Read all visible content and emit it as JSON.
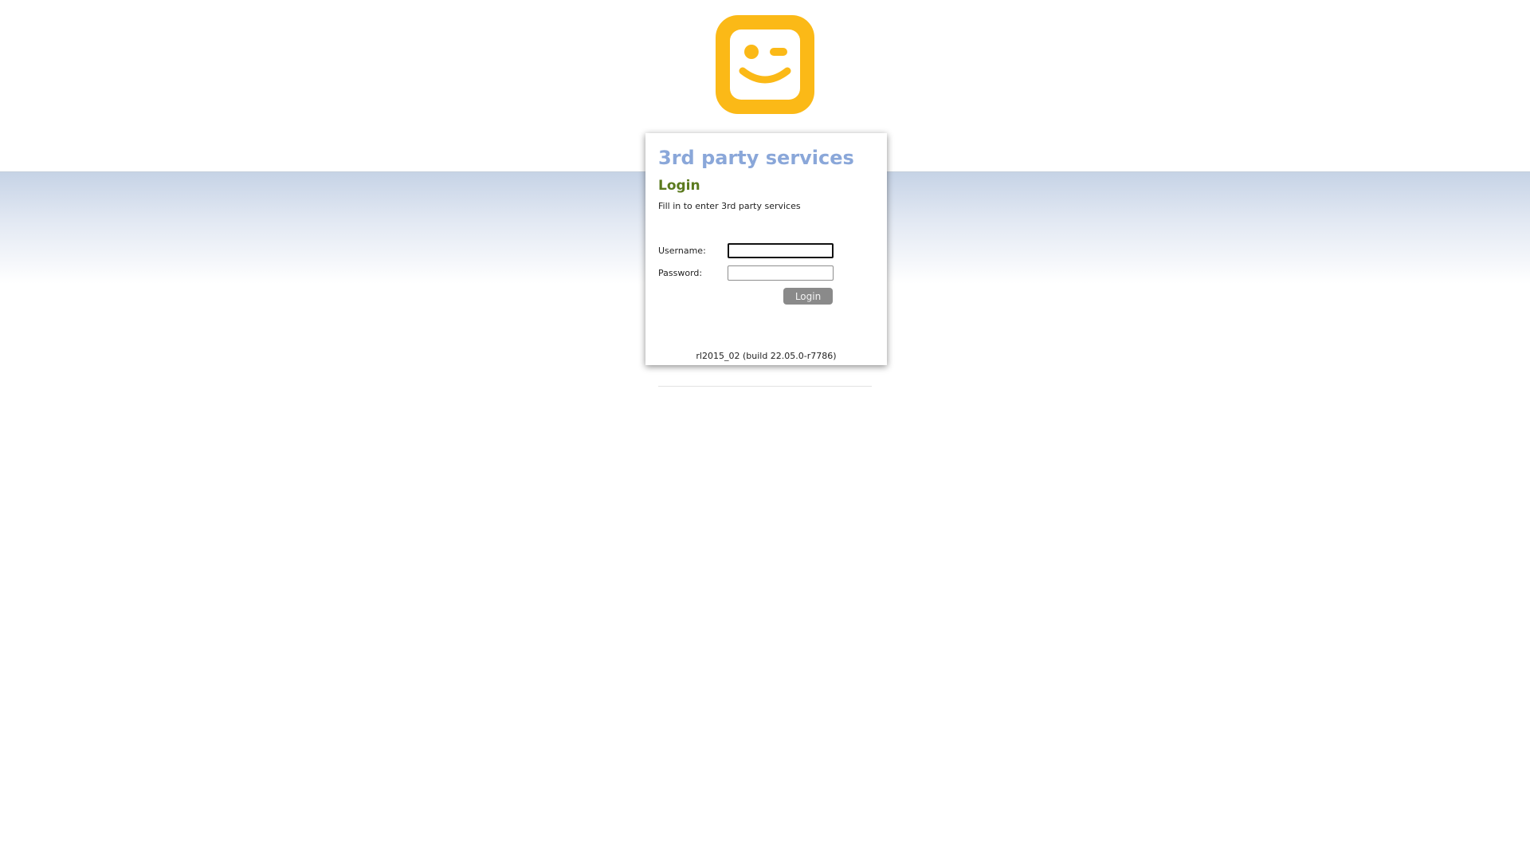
{
  "logo": {
    "icon": "winking-smiley-logo-icon",
    "color": "#fbb917"
  },
  "card": {
    "title": "3rd party services",
    "subtitle": "Login",
    "description": "Fill in to enter 3rd party services"
  },
  "form": {
    "username_label": "Username:",
    "username_value": "",
    "password_label": "Password:",
    "password_value": "",
    "login_button": "Login"
  },
  "footer": {
    "version": "rl2015_02 (build 22.05.0-r7786)"
  },
  "colors": {
    "title": "#8aa7d9",
    "subtitle": "#5b7a1e",
    "button": "#8a8a8a"
  }
}
